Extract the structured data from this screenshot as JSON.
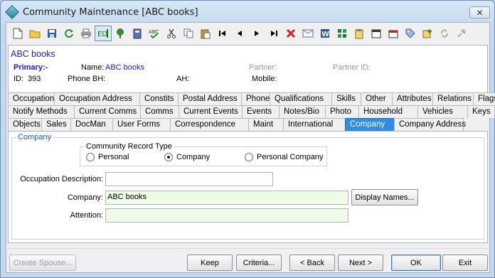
{
  "window": {
    "title": "Community Maintenance  [ABC books]",
    "close_glyph": "✕"
  },
  "toolbar": {
    "icons": [
      "new-document-icon",
      "open-folder-icon",
      "save-icon",
      "refresh-icon",
      "print-icon",
      "edit-icon",
      "tree-icon",
      "calculator-icon",
      "spellcheck-icon",
      "cut-icon",
      "copy-icon",
      "paste-icon",
      "first-record-icon",
      "previous-record-icon",
      "next-record-icon",
      "last-record-icon",
      "delete-icon",
      "email-icon",
      "word-icon",
      "excel-icon",
      "clipboard-icon",
      "calendar-icon",
      "report-icon",
      "tag-icon",
      "add-note-icon",
      "sync-icon",
      "tools-icon"
    ]
  },
  "record": {
    "name_heading": "ABC books",
    "primary_label": "Primary:-",
    "name_label": "Name:",
    "name_value": "ABC books",
    "partner_label": "Partner:",
    "partner_id_label": "Partner ID:",
    "id_label": "ID:",
    "id_value": "393",
    "phone_bh_label": "Phone BH:",
    "ah_label": "AH:",
    "mobile_label": "Mobile:"
  },
  "tabs": {
    "row1": [
      "Occupation",
      "Occupation Address",
      "Constits",
      "Postal Address",
      "Phone",
      "Qualifications",
      "Skills",
      "Other",
      "Attributes",
      "Relations",
      "Flags"
    ],
    "row2": [
      "Notify Methods",
      "Current Comms",
      "Comms",
      "Current Events",
      "Events",
      "Notes/Bio",
      "Photo",
      "Household",
      "Vehicles",
      "Keys"
    ],
    "row3": [
      "Objects",
      "Sales",
      "DocMan",
      "User Forms",
      "Correspondence",
      "Maint",
      "International",
      "Company",
      "Company Address"
    ],
    "active": "Company"
  },
  "company_panel": {
    "group_label": "Company",
    "record_type_label": "Community Record Type",
    "radio_options": [
      "Personal",
      "Company",
      "Personal Company"
    ],
    "selected_option": "Company",
    "occupation_description_label": "Occupation Description:",
    "occupation_description_value": "",
    "company_label": "Company:",
    "company_value": "ABC books",
    "display_names_button": "Display Names...",
    "attention_label": "Attention:",
    "attention_value": ""
  },
  "buttons": {
    "create_spouse": "Create Spouse...",
    "keep": "Keep",
    "criteria": "Criteria...",
    "back": "< Back",
    "next": "Next >",
    "ok": "OK",
    "exit": "Exit"
  }
}
